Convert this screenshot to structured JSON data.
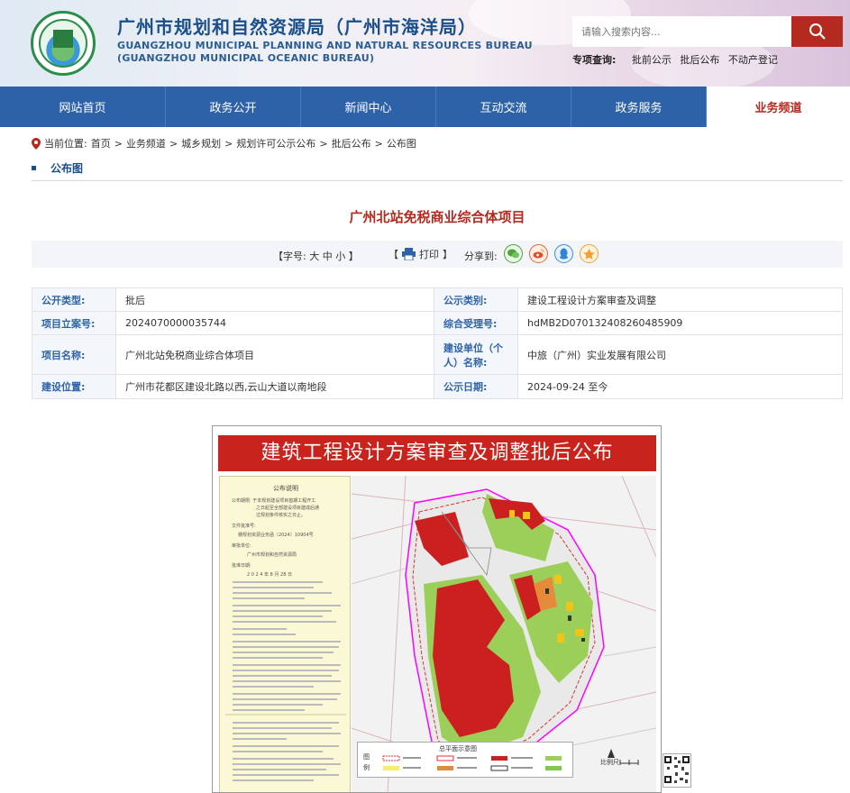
{
  "header": {
    "title_cn": "广州市规划和自然资源局（广州市海洋局）",
    "title_en_1": "GUANGZHOU MUNICIPAL PLANNING AND NATURAL RESOURCES BUREAU",
    "title_en_2": "(GUANGZHOU MUNICIPAL OCEANIC BUREAU)",
    "search_placeholder": "请输入搜索内容...",
    "quick_label": "专项查询:",
    "quick_links": [
      "批前公示",
      "批后公布",
      "不动产登记"
    ]
  },
  "nav": [
    "网站首页",
    "政务公开",
    "新闻中心",
    "互动交流",
    "政务服务",
    "业务频道"
  ],
  "breadcrumb": {
    "label": "当前位置:",
    "items": [
      "首页",
      "业务频道",
      "城乡规划",
      "规划许可公示公布",
      "批后公布",
      "公布图"
    ],
    "sep": ">"
  },
  "section_title": "公布图",
  "article_title": "广州北站免税商业综合体项目",
  "toolbar": {
    "font_size": "【字号:  大  中  小 】",
    "print": "打印",
    "print_wrap_l": "【",
    "print_wrap_r": "】",
    "share": "分享到:"
  },
  "info": {
    "r1": {
      "k1": "公开类型:",
      "v1": "批后",
      "k2": "公示类别:",
      "v2": "建设工程设计方案审查及调整"
    },
    "r2": {
      "k1": "项目立案号:",
      "v1": "2024070000035744",
      "k2": "综合受理号:",
      "v2": "hdMB2D070132408260485909"
    },
    "r3": {
      "k1": "项目名称:",
      "v1": "广州北站免税商业综合体项目",
      "k2": "建设单位（个人）名称:",
      "v2": "中旅（广州）实业发展有限公司"
    },
    "r4": {
      "k1": "建设位置:",
      "v1": "广州市花都区建设北路以西,云山大道以南地段",
      "k2": "公示日期:",
      "v2": "2024-09-24 至今"
    }
  },
  "notice": {
    "banner": "建筑工程设计方案审查及调整批后公布",
    "panel_title": "公布说明",
    "panel_lines": [
      "公布期限:  于本规划建设项目首期工程开工",
      "之日起至全部建设项目建成后通",
      "过规划条件核实之日止。",
      "文件批准号:",
      "穗规划资源业务函〔2024〕10904号",
      "审批单位:",
      "广州市规划和自然资源局",
      "批准日期:",
      "2 0 2 4 年 8 月 28 日"
    ],
    "legend_title": "总平面示意图",
    "legend_side": "图例",
    "scale_label": "比例尺:"
  },
  "colors": {
    "nav_bg": "#2e62a8",
    "accent_red": "#b52a1f",
    "banner_red": "#c8231c",
    "label_blue": "#2e62a8"
  }
}
